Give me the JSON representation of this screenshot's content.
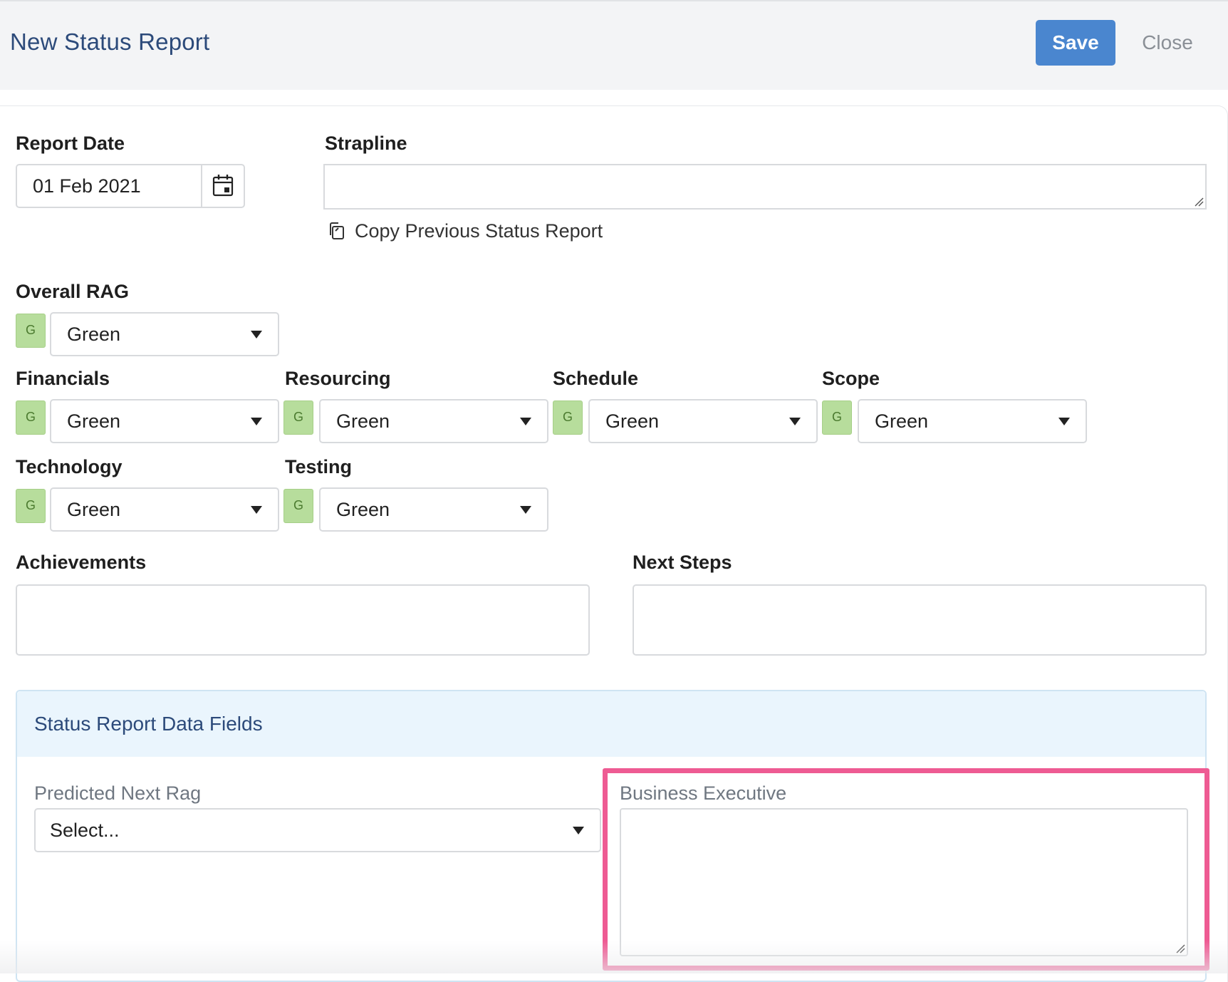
{
  "header": {
    "title": "New Status Report",
    "save_label": "Save",
    "close_label": "Close"
  },
  "form": {
    "report_date": {
      "label": "Report Date",
      "value": "01 Feb 2021",
      "icon": "calendar-icon"
    },
    "strapline": {
      "label": "Strapline",
      "value": ""
    },
    "copy_previous": {
      "label": "Copy Previous Status Report",
      "icon": "copy-icon"
    },
    "overall_rag": {
      "label": "Overall RAG",
      "badge": "G",
      "value": "Green"
    },
    "rag_fields": [
      {
        "label": "Financials",
        "badge": "G",
        "value": "Green"
      },
      {
        "label": "Resourcing",
        "badge": "G",
        "value": "Green"
      },
      {
        "label": "Schedule",
        "badge": "G",
        "value": "Green"
      },
      {
        "label": "Scope",
        "badge": "G",
        "value": "Green"
      },
      {
        "label": "Technology",
        "badge": "G",
        "value": "Green"
      },
      {
        "label": "Testing",
        "badge": "G",
        "value": "Green"
      }
    ],
    "achievements": {
      "label": "Achievements",
      "value": ""
    },
    "next_steps": {
      "label": "Next Steps",
      "value": ""
    }
  },
  "data_fields": {
    "title": "Status Report Data Fields",
    "predicted_next_rag": {
      "label": "Predicted Next Rag",
      "value": "Select..."
    },
    "business_executive": {
      "label": "Business Executive",
      "value": ""
    }
  },
  "colors": {
    "primary": "#4a86cf",
    "title": "#2c4a7a",
    "rag_green": "#b7dd9c",
    "highlight": "#ee5b93"
  }
}
